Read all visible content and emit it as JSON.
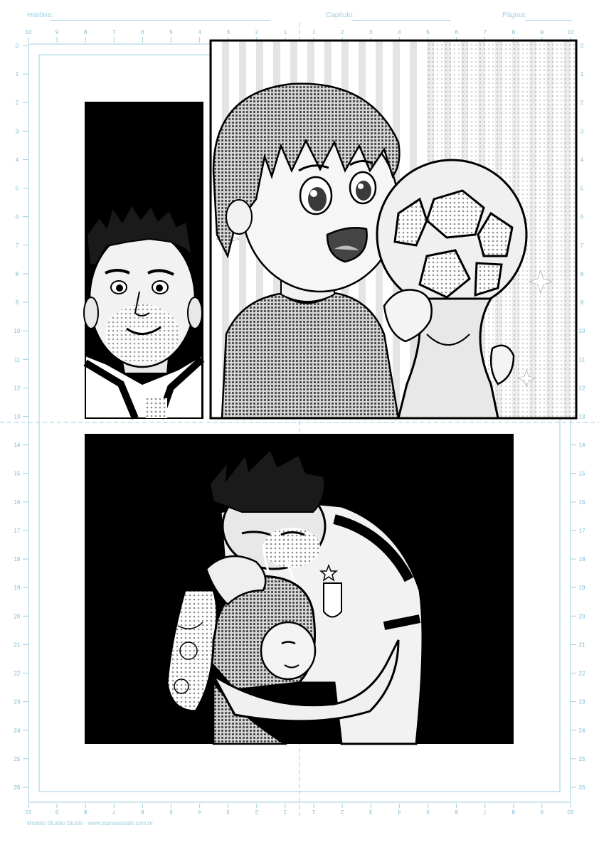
{
  "header": {
    "story_label": "História:",
    "chapter_label": "Capítulo:",
    "page_label": "Página:"
  },
  "rulers": {
    "top_ticks": [
      "10",
      "9",
      "8",
      "7",
      "6",
      "5",
      "4",
      "3",
      "2",
      "1",
      "1",
      "2",
      "3",
      "4",
      "5",
      "6",
      "7",
      "8",
      "9",
      "10"
    ],
    "bottom_ticks": [
      "10",
      "9",
      "8",
      "7",
      "6",
      "5",
      "4",
      "3",
      "2",
      "1",
      "1",
      "2",
      "3",
      "4",
      "5",
      "6",
      "7",
      "8",
      "9",
      "10"
    ],
    "side_ticks": [
      "0",
      "1",
      "2",
      "3",
      "4",
      "5",
      "6",
      "7",
      "8",
      "9",
      "10",
      "11",
      "12",
      "13",
      "14",
      "15",
      "16",
      "17",
      "18",
      "19",
      "20",
      "21",
      "22",
      "23",
      "24",
      "25",
      "26"
    ]
  },
  "footer": {
    "credit": "Modelo Sturião Studio - www.sturiaostudio.com.br"
  },
  "colors": {
    "guide_blue": "#7fbcd4",
    "ink": "#000000",
    "paper": "#ffffff"
  },
  "panels": [
    {
      "name": "panel-man-smiling",
      "description_icon": "smiling-man-portrait"
    },
    {
      "name": "panel-boy-with-trophy",
      "description_icon": "child-holding-trophy"
    },
    {
      "name": "panel-embrace",
      "description_icon": "man-hugging-child"
    }
  ]
}
